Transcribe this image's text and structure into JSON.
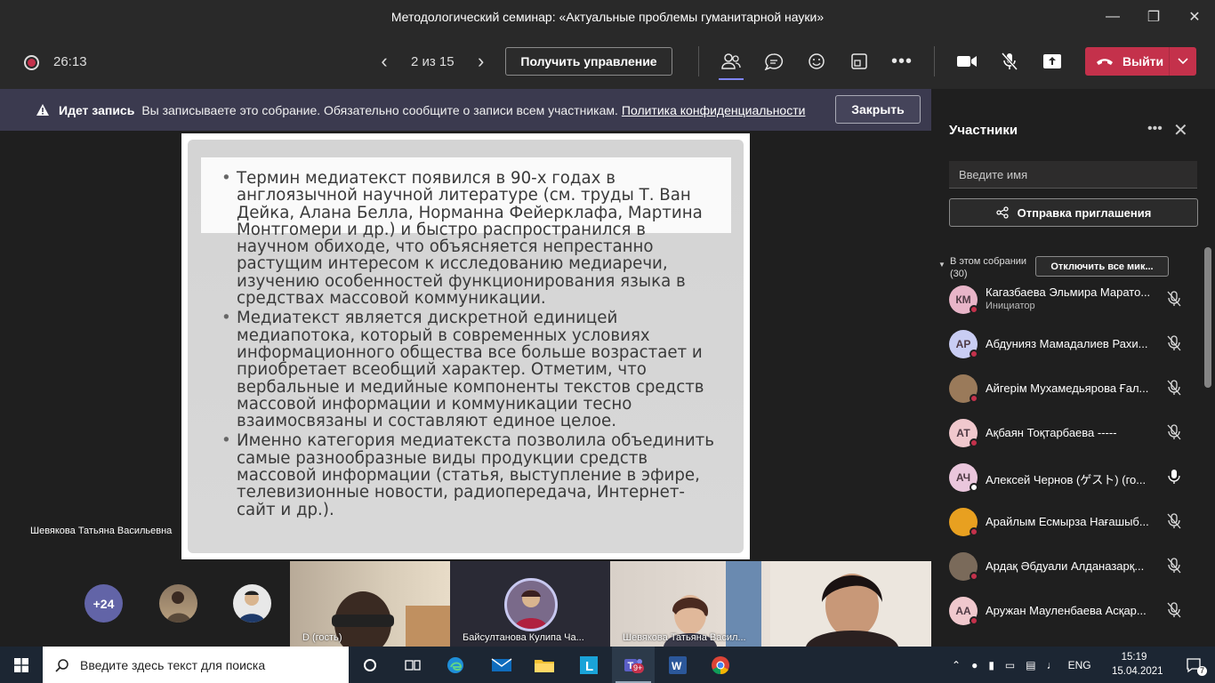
{
  "window": {
    "title": "Методологический семинар: «Актуальные проблемы гуманитарной науки»"
  },
  "toolbar": {
    "timer": "26:13",
    "page_indicator": "2 из 15",
    "take_control": "Получить управление",
    "leave": "Выйти",
    "colors": {
      "leave": "#c4314b",
      "accent": "#7f85f5"
    }
  },
  "banner": {
    "title": "Идет запись",
    "message": "Вы записываете это собрание. Обязательно сообщите о записи всем участникам.",
    "link": "Политика конфиденциальности",
    "dismiss": "Закрыть"
  },
  "slide": {
    "bullets": [
      " Термин медиатекст появился в 90-х годах в англоязычной научной литературе (см. труды Т. Ван Дейка, Алана Белла, Норманна Фейерклафа, Мартина Монтгомери и др.) и быстро распространился в научном обиходе, что объясняется непрестанно растущим интересом к исследованию медиаречи, изучению особенностей функционирования языка в средствах массовой коммуникации.",
      "Медиатекст является дискретной единицей медиапотока, который в современных условиях информационного общества все больше возрастает и приобретает всеобщий характер. Отметим, что вербальные и медийные компоненты текстов средств массовой информации и коммуникации тесно взаимосвязаны и составляют единое целое.",
      "Именно категория медиатекста позволила объединить самые разнообразные виды продукции средств массовой информации (статья, выступление в эфире, телевизионные новости, радиопередача, Интернет-сайт и др.)."
    ]
  },
  "presenter": {
    "name": "Шевякова Татьяна Васильевна"
  },
  "video_strip": {
    "more_count": "+24",
    "tiles": [
      {
        "label": "D (гость)"
      },
      {
        "label": "Байсултанова Кулипа Ча..."
      },
      {
        "label": "Шевякова Татьяна Васил..."
      },
      {
        "label": ""
      }
    ]
  },
  "participants": {
    "title": "Участники",
    "search_placeholder": "Введите имя",
    "invite": "Отправка приглашения",
    "section_line1": "В этом собрании",
    "section_line2": "(30)",
    "mute_all": "Отключить все мик...",
    "people": [
      {
        "initials": "КМ",
        "name": "Кагазбаева Эльмира Марато...",
        "role": "Инициатор",
        "color": "#e8b5c8",
        "muted": true
      },
      {
        "initials": "АР",
        "name": "Абдунияз Мамадалиев Рахи...",
        "role": "",
        "color": "#c9cdf3",
        "muted": true
      },
      {
        "initials": "",
        "name": "Айгерім Мухамедьярова Ғал...",
        "role": "",
        "color": "#9a7a5a",
        "muted": true
      },
      {
        "initials": "АТ",
        "name": "Ақбаян Тоқтарбаева -----",
        "role": "",
        "color": "#f0c8cd",
        "muted": true
      },
      {
        "initials": "АЧ",
        "name": "Алексей Чернов (ゲスト) (го...",
        "role": "",
        "color": "#eac6dc",
        "muted": false
      },
      {
        "initials": "",
        "name": "Арайлым Есмырза Нағашыб...",
        "role": "",
        "color": "#e8a020",
        "muted": true
      },
      {
        "initials": "",
        "name": "Ардақ Әбдуали Алданазарқ...",
        "role": "",
        "color": "#7a6a5a",
        "muted": true
      },
      {
        "initials": "АА",
        "name": "Аружан Мауленбаева Асқар...",
        "role": "",
        "color": "#f0c8cd",
        "muted": true
      }
    ]
  },
  "taskbar": {
    "search_placeholder": "Введите здесь текст для поиска",
    "lang": "ENG",
    "time": "15:19",
    "date": "15.04.2021",
    "teams_badge": "9+",
    "notif_count": "7"
  }
}
